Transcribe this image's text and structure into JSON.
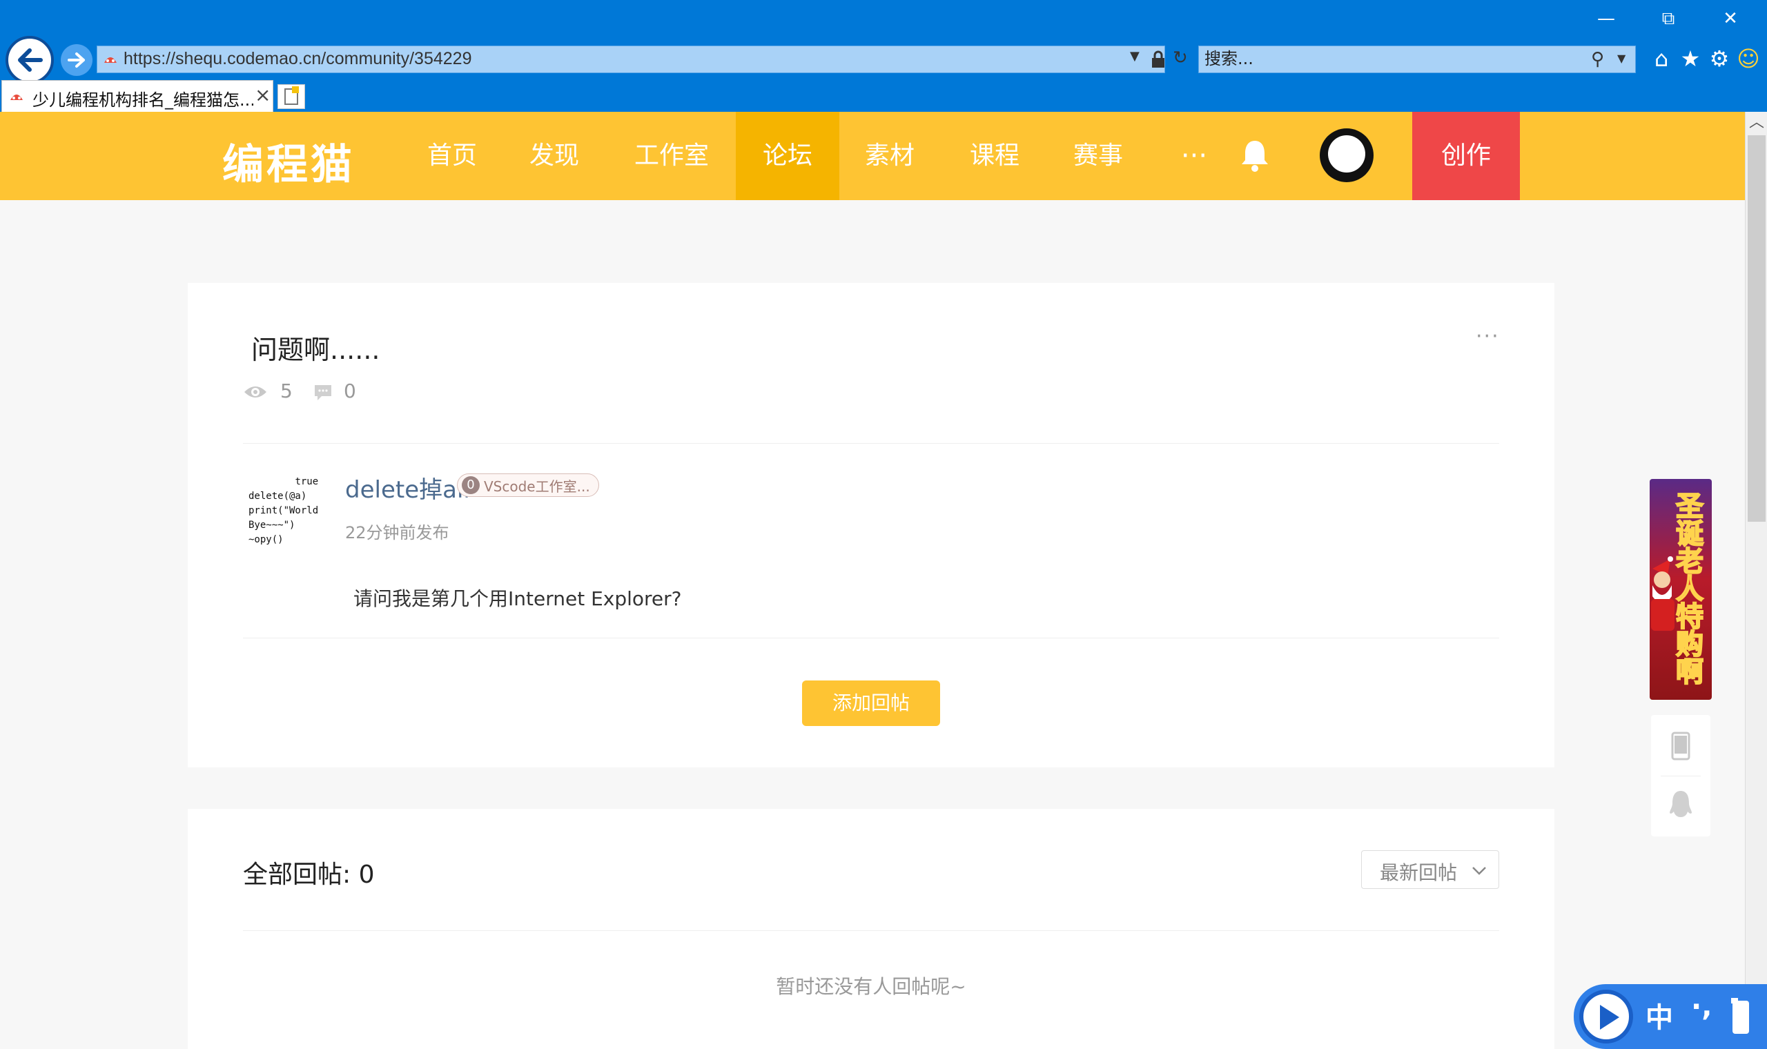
{
  "browser": {
    "address": "https://shequ.codemao.cn/community/354229",
    "search_placeholder": "搜索...",
    "tab_title": "少儿编程机构排名_编程猫怎...",
    "window_controls": {
      "minimize": "—",
      "restore": "⧉",
      "close": "✕"
    },
    "icons": [
      "back-arrow-icon",
      "forward-arrow-icon",
      "lock-icon",
      "refresh-icon",
      "search-icon",
      "home-icon",
      "star-icon",
      "gear-icon",
      "smiley-icon"
    ]
  },
  "site": {
    "logo": "编程猫",
    "nav": {
      "home": "首页",
      "discover": "发现",
      "studio": "工作室",
      "forum": "论坛",
      "material": "素材",
      "course": "课程",
      "contest": "赛事",
      "more": "···"
    },
    "create": "创作",
    "accent_color": "#fec433",
    "create_color": "#ef4748"
  },
  "post": {
    "title": "问题啊......",
    "views": "5",
    "comments": "0",
    "menu": "···",
    "author": {
      "name": "delete掉all",
      "badge_level": "0",
      "badge_text": "VScode工作室...",
      "avatar_code": "\ttrue):\ndelete(@a)\nprint(\"World\nBye~~~\")\n~opy()"
    },
    "time": "22分钟前发布",
    "body": "请问我是第几个用Internet Explorer?",
    "add_reply": "添加回帖"
  },
  "replies": {
    "header": "全部回帖: 0",
    "sort": "最新回帖",
    "empty": "暂时还没有人回帖呢~"
  },
  "promo": {
    "text": "圣诞老人特购啊"
  },
  "ime": {
    "lang": "中",
    "punct": "·,"
  }
}
